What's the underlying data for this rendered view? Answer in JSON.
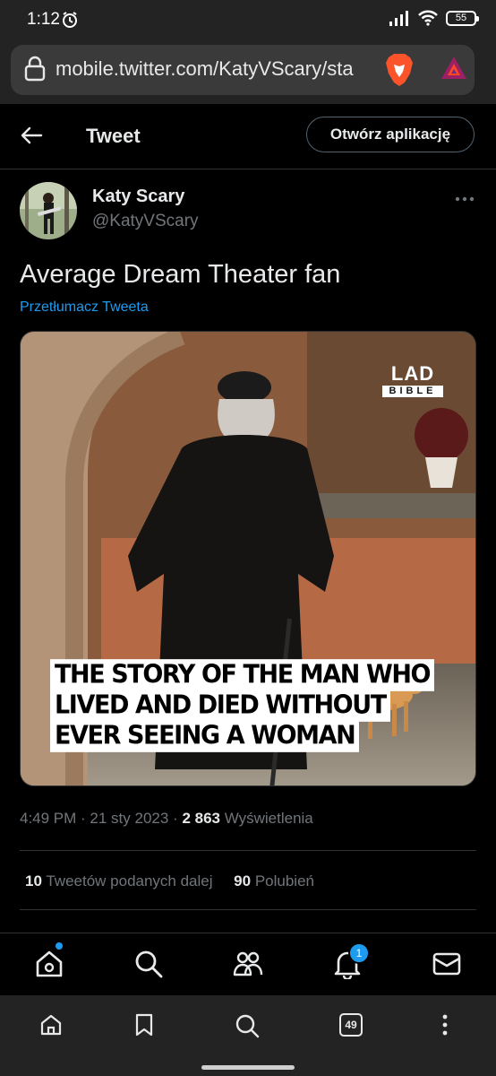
{
  "status": {
    "time": "1:12",
    "battery": "55"
  },
  "browser": {
    "url": "mobile.twitter.com/KatyVScary/sta",
    "tab_count": "49"
  },
  "header": {
    "title": "Tweet",
    "open_app_label": "Otwórz aplikację"
  },
  "author": {
    "name": "Katy Scary",
    "handle": "@KatyVScary"
  },
  "tweet": {
    "text": "Average Dream Theater fan",
    "translate_label": "Przetłumacz Tweeta",
    "media": {
      "logo_top": "LAD",
      "logo_bottom": "BIBLE",
      "caption_lines": [
        "THE STORY OF THE MAN WHO",
        "LIVED AND DIED WITHOUT",
        "EVER SEEING A WOMAN"
      ]
    },
    "time": "4:49 PM",
    "date": "21 sty 2023",
    "views_count": "2 863",
    "views_label": "Wyświetlenia",
    "retweets_count": "10",
    "retweets_label": "Tweetów podanych dalej",
    "likes_count": "90",
    "likes_label": "Polubień"
  },
  "nav": {
    "notifications_badge": "1",
    "icons": [
      "home-icon",
      "search-icon",
      "communities-icon",
      "bell-icon",
      "mail-icon"
    ]
  },
  "colors": {
    "accent": "#1d9bf0",
    "background": "#000000",
    "muted": "#71767b"
  }
}
